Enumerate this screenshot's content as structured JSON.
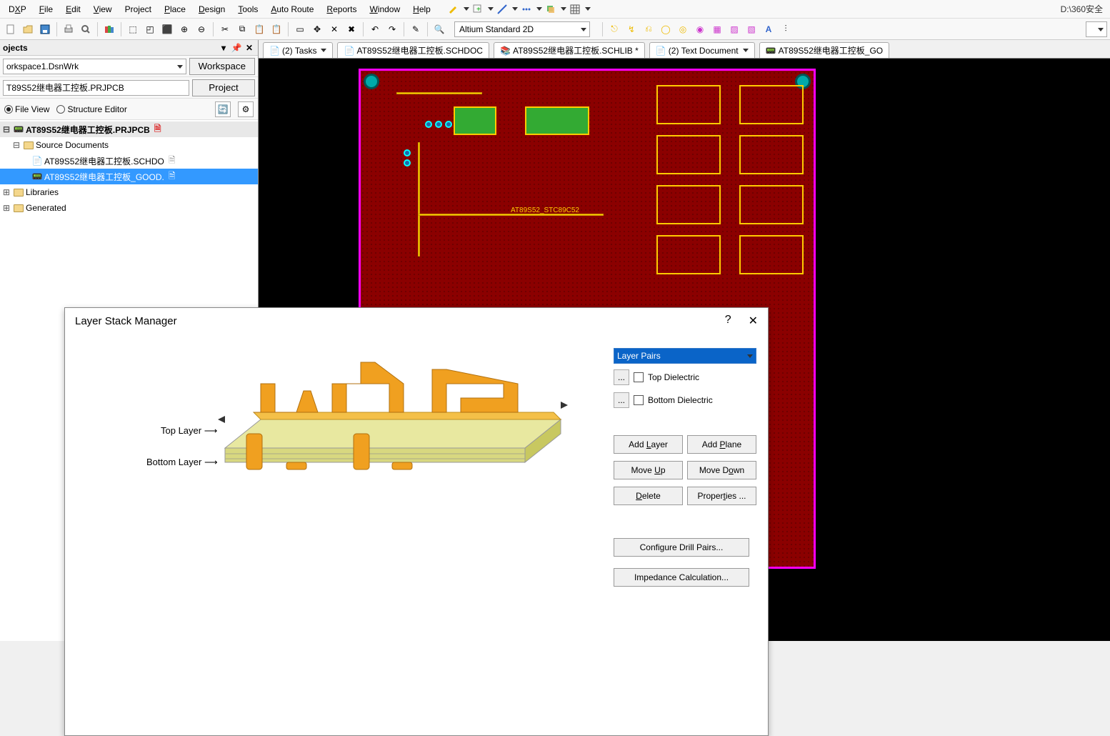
{
  "menu": {
    "dxp": "DXP",
    "file": "File",
    "edit": "Edit",
    "view": "View",
    "project": "Project",
    "place": "Place",
    "design": "Design",
    "tools": "Tools",
    "autoroute": "Auto Route",
    "reports": "Reports",
    "window": "Window",
    "help": "Help"
  },
  "path": "D:\\360安全",
  "toolbar_combo": "Altium Standard 2D",
  "projects": {
    "panel_title": "ojects",
    "workspace": "orkspace1.DsnWrk",
    "workspace_btn": "Workspace",
    "project": "T89S52继电器工控板.PRJPCB",
    "project_btn": "Project",
    "radio1": "File View",
    "radio2": "Structure Editor",
    "root": "AT89S52继电器工控板.PRJPCB",
    "src": "Source Documents",
    "doc1": "AT89S52继电器工控板.SCHDO",
    "doc2": "AT89S52继电器工控板_GOOD.",
    "lib": "Libraries",
    "gen": "Generated"
  },
  "tabs": {
    "t1": "(2) Tasks",
    "t2": "AT89S52继电器工控板.SCHDOC",
    "t3": "AT89S52继电器工控板.SCHLIB *",
    "t4": "(2) Text Document",
    "t5": "AT89S52继电器工控板_GO"
  },
  "dialog": {
    "title": "Layer Stack Manager",
    "drop": "Layer Pairs",
    "chk1": "Top Dielectric",
    "chk2": "Bottom Dielectric",
    "lbl_top": "Top Layer",
    "lbl_bot": "Bottom Layer",
    "addlayer": "Add Layer",
    "addplane": "Add Plane",
    "moveup": "Move Up",
    "movedown": "Move Down",
    "delete": "Delete",
    "props": "Properties ...",
    "drill": "Configure Drill Pairs...",
    "imped": "Impedance Calculation..."
  }
}
